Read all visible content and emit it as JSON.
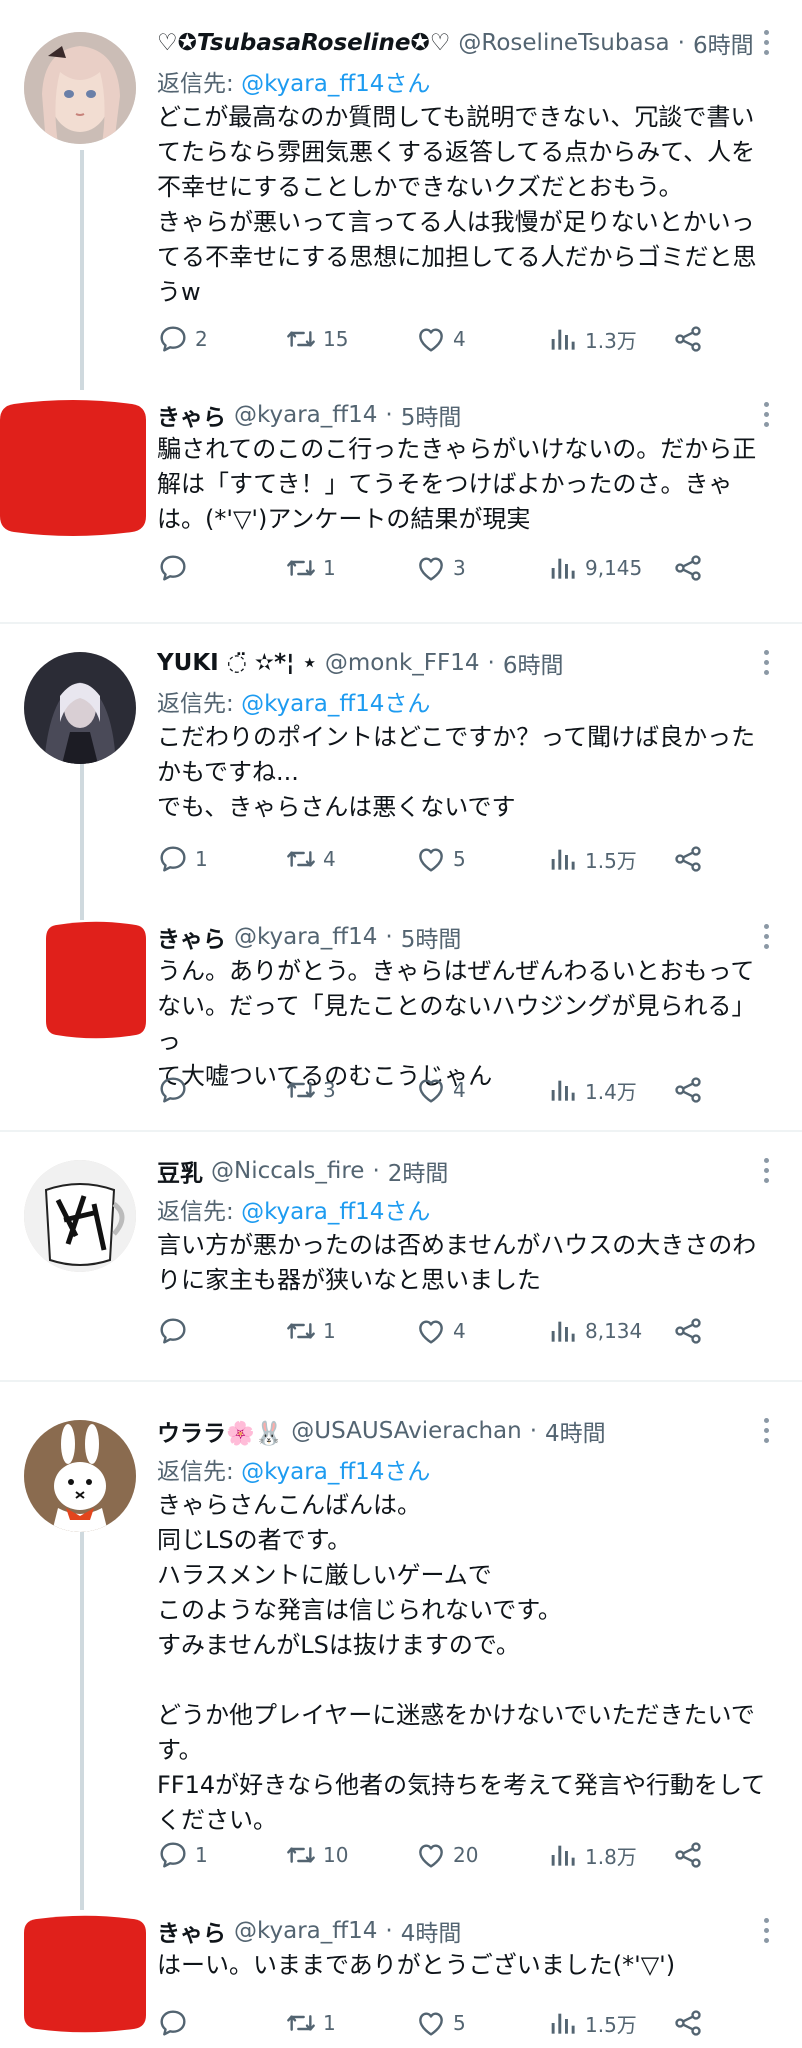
{
  "tweets": [
    {
      "name": "♡✪TsubasaRoseline✪♡",
      "handle": "@RoselineTsubasa",
      "dot": "·",
      "time": "6時間",
      "reply_prefix": "返信先: ",
      "reply_to": "@kyara_ff14さん",
      "text": "どこが最高なのか質問しても説明できない、冗談で書い\nてたらなら雰囲気悪くする返答してる点からみて、人を\n不幸せにすることしかできないクズだとおもう。\nきゃらが悪いって言ってる人は我慢が足りないとかいっ\nてる不幸せにする思想に加担してる人だからゴミだと思\nうw",
      "replies": "2",
      "retweets": "15",
      "likes": "4",
      "views": "1.3万"
    },
    {
      "name": "きゃら",
      "handle": "@kyara_ff14",
      "dot": "·",
      "time": "5時間",
      "text": "騙されてのこのこ行ったきゃらがいけないの。だから正\n解は「すてき！」てうそをつけばよかったのさ。きゃ\nは。(*'▽')アンケートの結果が現実",
      "replies": "",
      "retweets": "1",
      "likes": "3",
      "views": "9,145"
    },
    {
      "name": "YUKI ◌̈ ✫*¦ ⋆",
      "handle": "@monk_FF14",
      "dot": "·",
      "time": "6時間",
      "reply_prefix": "返信先: ",
      "reply_to": "@kyara_ff14さん",
      "text": "こだわりのポイントはどこですか？って聞けば良かった\nかもですね...\nでも、きゃらさんは悪くないです",
      "replies": "1",
      "retweets": "4",
      "likes": "5",
      "views": "1.5万"
    },
    {
      "name": "きゃら",
      "handle": "@kyara_ff14",
      "dot": "·",
      "time": "5時間",
      "text": "うん。ありがとう。きゃらはぜんぜんわるいとおもって\nない。だって「見たことのないハウジングが見られる」っ\nて大嘘ついてるのむこうじゃん",
      "replies": "",
      "retweets": "3",
      "likes": "4",
      "views": "1.4万"
    },
    {
      "name": "豆乳",
      "handle": "@Niccals_fire",
      "dot": "·",
      "time": "2時間",
      "reply_prefix": "返信先: ",
      "reply_to": "@kyara_ff14さん",
      "text": "言い方が悪かったのは否めませんがハウスの大きさのわ\nりに家主も器が狭いなと思いました",
      "replies": "",
      "retweets": "1",
      "likes": "4",
      "views": "8,134"
    },
    {
      "name": "ウララ🌸🐰",
      "handle": "@USAUSAvierachan",
      "dot": "·",
      "time": "4時間",
      "reply_prefix": "返信先: ",
      "reply_to": "@kyara_ff14さん",
      "text": "きゃらさんこんばんは。\n同じLSの者です。\nハラスメントに厳しいゲームで\nこのような発言は信じられないです。\nすみませんがLSは抜けますので。\n\nどうか他プレイヤーに迷惑をかけないでいただきたいで\nす。\nFF14が好きなら他者の気持ちを考えて発言や行動をして\nください。",
      "replies": "1",
      "retweets": "10",
      "likes": "20",
      "views": "1.8万"
    },
    {
      "name": "きゃら",
      "handle": "@kyara_ff14",
      "dot": "·",
      "time": "4時間",
      "text": "はーい。いままでありがとうございました(*'▽')",
      "replies": "",
      "retweets": "1",
      "likes": "5",
      "views": "1.5万"
    }
  ],
  "colors": {
    "link": "#1d9bf0",
    "muted": "#536471",
    "thread_line": "#cfd9de",
    "avatar_red": "#e0201b"
  },
  "icons": [
    "reply-icon",
    "retweet-icon",
    "like-icon",
    "views-icon",
    "share-icon",
    "more-icon"
  ]
}
